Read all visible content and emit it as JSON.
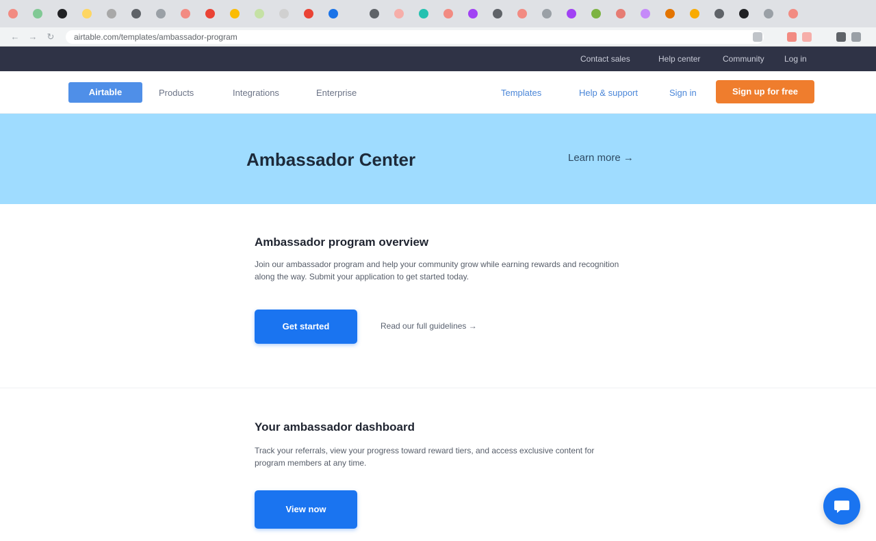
{
  "browser": {
    "tab_colors": [
      "#f28b82",
      "#81c995",
      "#202124",
      "#fdd663",
      "#a8a8a8",
      "#5f6368",
      "#9aa0a6",
      "#f28b82",
      "#ea4335",
      "#fbbc04",
      "#c5e1a5",
      "#d0d0d0",
      "#ea4335",
      "#1a73e8",
      "#5f6368",
      "#f6aea9",
      "#24c1b0",
      "#f28b82",
      "#a142f4",
      "#5f6368",
      "#f28b82",
      "#9aa0a6",
      "#a142f4",
      "#7cb342",
      "#e67c73",
      "#c58af9",
      "#e37400",
      "#f9ab00",
      "#5f6368",
      "#202124",
      "#9aa0a6",
      "#f28b82"
    ],
    "url": "airtable.com/templates/ambassador-program",
    "back_icon": "back-arrow-icon",
    "forward_icon": "forward-arrow-icon",
    "reload_icon": "reload-icon"
  },
  "utility_bar": {
    "links": [
      "Contact sales",
      "Help center",
      "Community",
      "Log in"
    ]
  },
  "nav": {
    "logo": "Airtable",
    "left_links": [
      "Products",
      "Integrations",
      "Enterprise"
    ],
    "right_links": [
      "Templates",
      "Help & support",
      "Sign in"
    ],
    "cta": "Sign up for free"
  },
  "hero": {
    "title": "Ambassador Center",
    "link": "Learn more →"
  },
  "section1": {
    "title": "Ambassador program overview",
    "body_line1": "Join our ambassador program and help your community grow while earning rewards and recognition",
    "body_line2": "along the way. Submit your application to get started today.",
    "button": "Get started",
    "link": "Read our full guidelines →"
  },
  "section2": {
    "title": "Your ambassador dashboard",
    "body_line1": "Track your referrals, view your progress toward reward tiers, and access exclusive content for",
    "body_line2": "program members at any time.",
    "button": "View now"
  },
  "colors": {
    "utility_bar": "#2f3346",
    "hero": "#9fdcff",
    "primary": "#1a74f0",
    "cta": "#ef7d2d"
  }
}
